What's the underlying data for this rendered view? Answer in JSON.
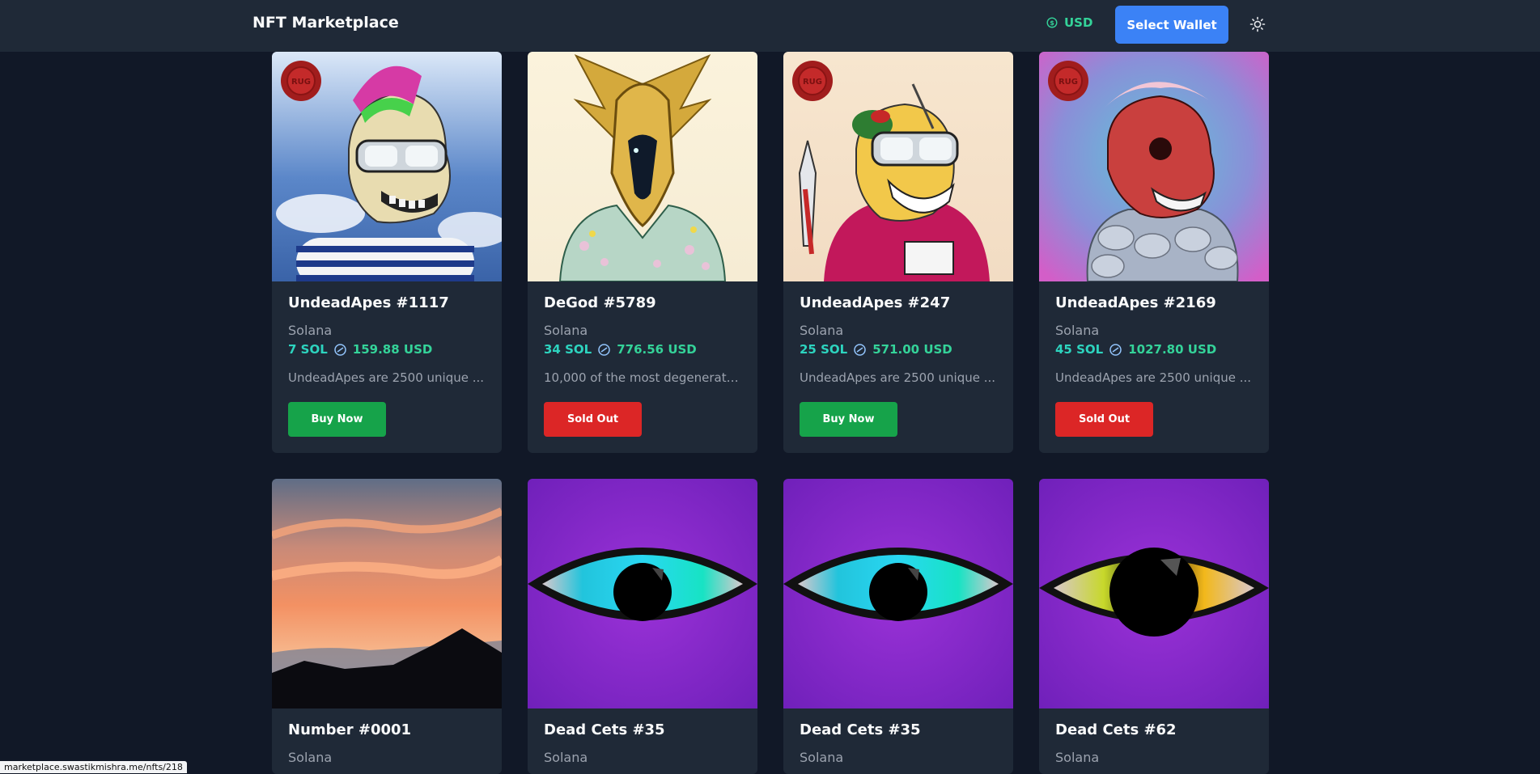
{
  "header": {
    "brand": "NFT Marketplace",
    "currency_label": "USD",
    "wallet_button": "Select Wallet",
    "theme_icon": "sun-icon",
    "currency_icon": "dollar-coin-icon"
  },
  "colors": {
    "page_bg": "#111827",
    "card_bg": "#1f2937",
    "accent_blue": "#3b82f6",
    "buy_green": "#16a34a",
    "sold_red": "#dc2626",
    "sol_teal": "#2dd4bf",
    "usd_green": "#34d399"
  },
  "cards": [
    {
      "name": "UndeadApes #1117",
      "chain": "Solana",
      "sol": "7 SOL",
      "usd": "159.88 USD",
      "desc": "UndeadApes are 2500 unique ...",
      "action": "Buy Now",
      "status": "buy",
      "art": "undead-ape-green-mohawk-image",
      "badge": "RUG"
    },
    {
      "name": "DeGod #5789",
      "chain": "Solana",
      "sol": "34 SOL",
      "usd": "776.56 USD",
      "desc": "10,000 of the most degenerate...",
      "action": "Sold Out",
      "status": "sold",
      "art": "degod-golden-helmet-image"
    },
    {
      "name": "UndeadApes #247",
      "chain": "Solana",
      "sol": "25 SOL",
      "usd": "571.00 USD",
      "desc": "UndeadApes are 2500 unique ...",
      "action": "Buy Now",
      "status": "buy",
      "art": "undead-ape-pink-hoodie-image",
      "badge": "RUG"
    },
    {
      "name": "UndeadApes #2169",
      "chain": "Solana",
      "sol": "45 SOL",
      "usd": "1027.80 USD",
      "desc": "UndeadApes are 2500 unique ...",
      "action": "Sold Out",
      "status": "sold",
      "art": "undead-ape-red-skull-image",
      "badge": "RUG"
    },
    {
      "name": "Number #0001",
      "chain": "Solana",
      "art": "sunset-mountains-image"
    },
    {
      "name": "Dead Cets #35",
      "chain": "Solana",
      "art": "cyan-eye-image"
    },
    {
      "name": "Dead Cets #35",
      "chain": "Solana",
      "art": "cyan-eye-image"
    },
    {
      "name": "Dead Cets #62",
      "chain": "Solana",
      "art": "yellow-eye-image"
    }
  ],
  "statusbar": {
    "url": "marketplace.swastikmishra.me/nfts/218"
  }
}
